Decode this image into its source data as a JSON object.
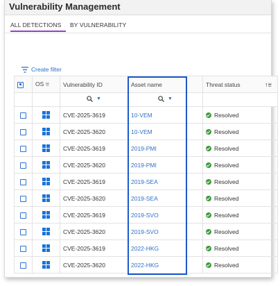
{
  "app": {
    "title": "Vulnerability Management"
  },
  "tabs": [
    {
      "label": "ALL DETECTIONS",
      "active": true
    },
    {
      "label": "BY VULNERABILITY",
      "active": false
    }
  ],
  "filter": {
    "label": "Create filter"
  },
  "columns": {
    "os": "OS",
    "vulnerability_id": "Vulnerability ID",
    "asset_name": "Asset name",
    "threat_status": "Threat status"
  },
  "colors": {
    "accent_tab": "#9b3bc4",
    "link": "#2f6fc7",
    "resolved": "#3a9a3a",
    "highlight": "#1b58c9"
  },
  "rows": [
    {
      "os_icon": "windows-icon",
      "vuln_id": "CVE-2025-3619",
      "asset": "10-VEM",
      "status": "Resolved"
    },
    {
      "os_icon": "windows-icon",
      "vuln_id": "CVE-2025-3620",
      "asset": "10-VEM",
      "status": "Resolved"
    },
    {
      "os_icon": "windows-icon",
      "vuln_id": "CVE-2025-3619",
      "asset": "2019-PMI",
      "status": "Resolved"
    },
    {
      "os_icon": "windows-icon",
      "vuln_id": "CVE-2025-3620",
      "asset": "2019-PMI",
      "status": "Resolved"
    },
    {
      "os_icon": "windows-icon",
      "vuln_id": "CVE-2025-3619",
      "asset": "2019-SEA",
      "status": "Resolved"
    },
    {
      "os_icon": "windows-icon",
      "vuln_id": "CVE-2025-3620",
      "asset": "2019-SEA",
      "status": "Resolved"
    },
    {
      "os_icon": "windows-icon",
      "vuln_id": "CVE-2025-3619",
      "asset": "2019-SVO",
      "status": "Resolved"
    },
    {
      "os_icon": "windows-icon",
      "vuln_id": "CVE-2025-3620",
      "asset": "2019-SVO",
      "status": "Resolved"
    },
    {
      "os_icon": "windows-icon",
      "vuln_id": "CVE-2025-3619",
      "asset": "2022-HKG",
      "status": "Resolved"
    },
    {
      "os_icon": "windows-icon",
      "vuln_id": "CVE-2025-3620",
      "asset": "2022-HKG",
      "status": "Resolved"
    }
  ]
}
